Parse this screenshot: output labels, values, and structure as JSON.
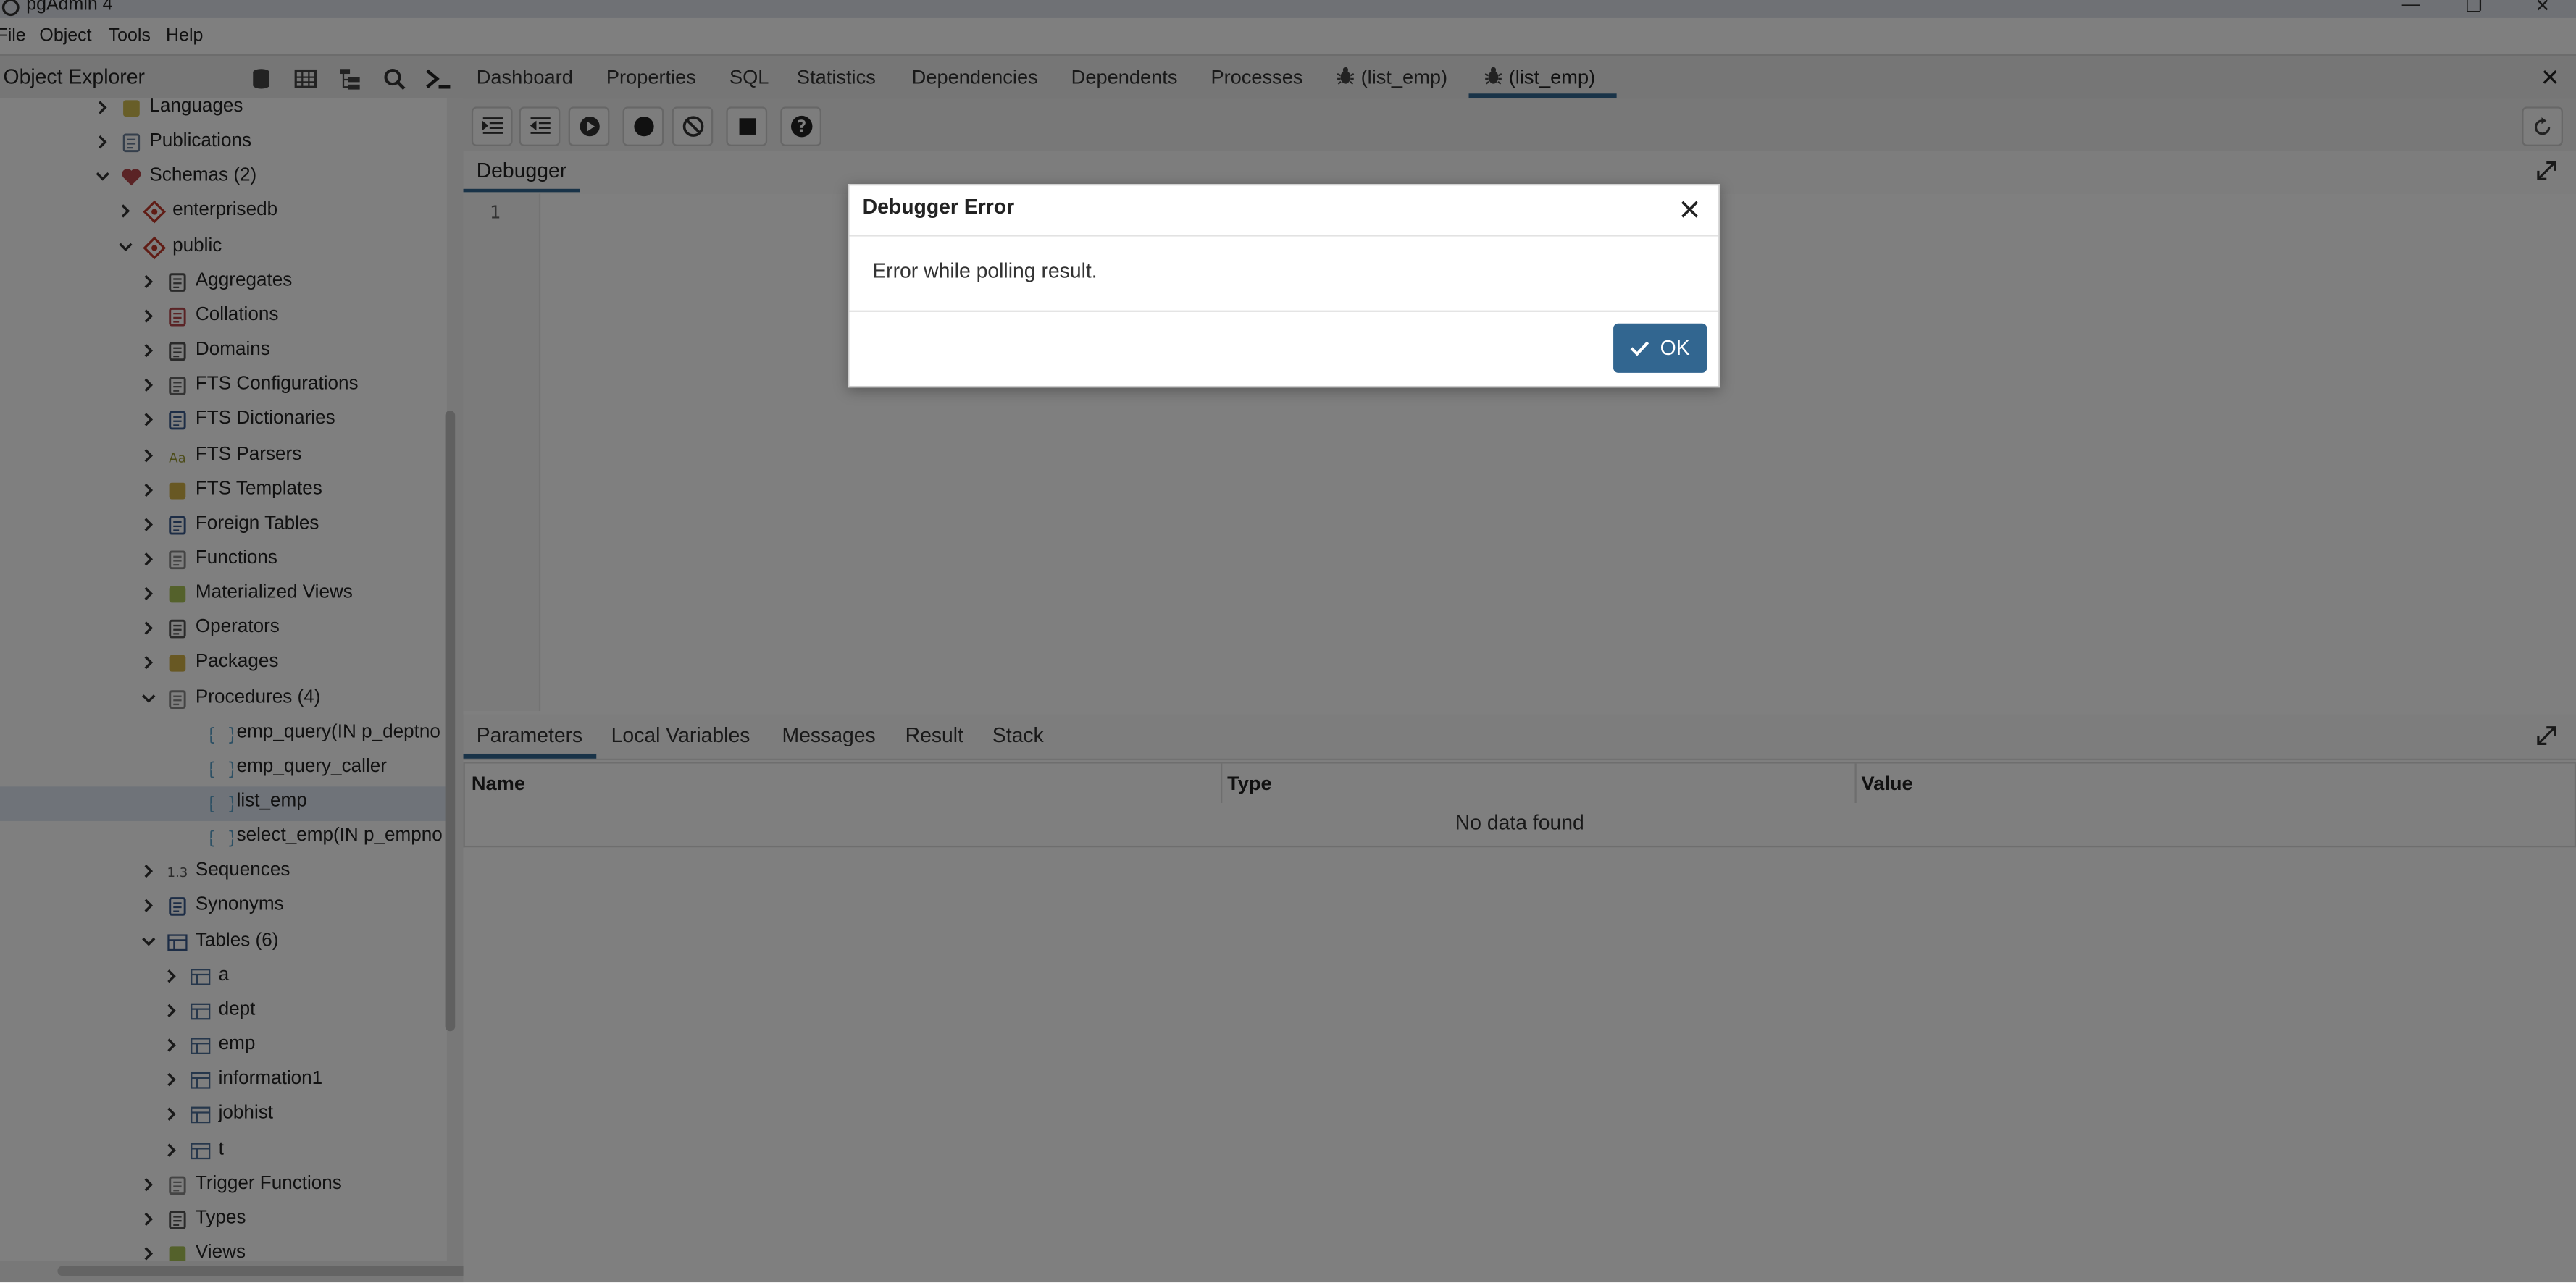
{
  "window": {
    "title": "pgAdmin 4",
    "controls": [
      "—",
      "❐",
      "✕"
    ]
  },
  "menu": [
    "File",
    "Object",
    "Tools",
    "Help"
  ],
  "object_explorer": {
    "title": "Object Explorer",
    "toolbar_icons": [
      "database-icon",
      "table-icon",
      "hierarchy-icon",
      "search-icon",
      "terminal-icon"
    ],
    "tree": [
      {
        "label": "Languages",
        "depth": 2,
        "expanded": false,
        "icon": "languages-icon"
      },
      {
        "label": "Publications",
        "depth": 2,
        "expanded": false,
        "icon": "publications-icon"
      },
      {
        "label": "Schemas (2)",
        "depth": 2,
        "expanded": true,
        "icon": "schemas-icon"
      },
      {
        "label": "enterprisedb",
        "depth": 3,
        "expanded": false,
        "icon": "schema-icon"
      },
      {
        "label": "public",
        "depth": 3,
        "expanded": true,
        "icon": "schema-icon"
      },
      {
        "label": "Aggregates",
        "depth": 4,
        "expanded": false,
        "icon": "aggregates-icon"
      },
      {
        "label": "Collations",
        "depth": 4,
        "expanded": false,
        "icon": "collations-icon"
      },
      {
        "label": "Domains",
        "depth": 4,
        "expanded": false,
        "icon": "domains-icon"
      },
      {
        "label": "FTS Configurations",
        "depth": 4,
        "expanded": false,
        "icon": "fts-config-icon"
      },
      {
        "label": "FTS Dictionaries",
        "depth": 4,
        "expanded": false,
        "icon": "fts-dict-icon"
      },
      {
        "label": "FTS Parsers",
        "depth": 4,
        "expanded": false,
        "icon": "fts-parser-icon"
      },
      {
        "label": "FTS Templates",
        "depth": 4,
        "expanded": false,
        "icon": "fts-template-icon"
      },
      {
        "label": "Foreign Tables",
        "depth": 4,
        "expanded": false,
        "icon": "foreign-table-icon"
      },
      {
        "label": "Functions",
        "depth": 4,
        "expanded": false,
        "icon": "functions-icon"
      },
      {
        "label": "Materialized Views",
        "depth": 4,
        "expanded": false,
        "icon": "matview-icon"
      },
      {
        "label": "Operators",
        "depth": 4,
        "expanded": false,
        "icon": "operators-icon"
      },
      {
        "label": "Packages",
        "depth": 4,
        "expanded": false,
        "icon": "packages-icon"
      },
      {
        "label": "Procedures (4)",
        "depth": 4,
        "expanded": true,
        "icon": "procedures-icon"
      },
      {
        "label": "emp_query(IN p_deptno num",
        "depth": 5,
        "leaf": true,
        "icon": "procedure-icon"
      },
      {
        "label": "emp_query_caller",
        "depth": 5,
        "leaf": true,
        "icon": "procedure-icon"
      },
      {
        "label": "list_emp",
        "depth": 5,
        "leaf": true,
        "icon": "procedure-icon",
        "selected": true
      },
      {
        "label": "select_emp(IN p_empno nu",
        "depth": 5,
        "leaf": true,
        "icon": "procedure-icon"
      },
      {
        "label": "Sequences",
        "depth": 4,
        "expanded": false,
        "icon": "sequences-icon"
      },
      {
        "label": "Synonyms",
        "depth": 4,
        "expanded": false,
        "icon": "synonyms-icon"
      },
      {
        "label": "Tables (6)",
        "depth": 4,
        "expanded": true,
        "icon": "tables-icon"
      },
      {
        "label": "a",
        "depth": 5,
        "expanded": false,
        "icon": "table-icon"
      },
      {
        "label": "dept",
        "depth": 5,
        "expanded": false,
        "icon": "table-icon"
      },
      {
        "label": "emp",
        "depth": 5,
        "expanded": false,
        "icon": "table-icon"
      },
      {
        "label": "information1",
        "depth": 5,
        "expanded": false,
        "icon": "table-icon"
      },
      {
        "label": "jobhist",
        "depth": 5,
        "expanded": false,
        "icon": "table-icon"
      },
      {
        "label": "t",
        "depth": 5,
        "expanded": false,
        "icon": "table-icon"
      },
      {
        "label": "Trigger Functions",
        "depth": 4,
        "expanded": false,
        "icon": "trigger-functions-icon"
      },
      {
        "label": "Types",
        "depth": 4,
        "expanded": false,
        "icon": "types-icon"
      },
      {
        "label": "Views",
        "depth": 4,
        "expanded": false,
        "icon": "views-icon"
      }
    ]
  },
  "tabs": [
    {
      "label": "Dashboard"
    },
    {
      "label": "Properties"
    },
    {
      "label": "SQL"
    },
    {
      "label": "Statistics"
    },
    {
      "label": "Dependencies"
    },
    {
      "label": "Dependents"
    },
    {
      "label": "Processes"
    },
    {
      "label": "(list_emp)",
      "icon": "bug-icon"
    },
    {
      "label": "(list_emp)",
      "icon": "bug-icon",
      "active": true
    }
  ],
  "debugger": {
    "toolbar": [
      "step-into-icon",
      "step-over-icon",
      "continue-icon",
      "breakpoint-icon",
      "clear-breakpoints-icon",
      "stop-icon",
      "help-icon"
    ],
    "panel_title": "Debugger",
    "line_number": "1",
    "bottom_tabs": [
      "Parameters",
      "Local Variables",
      "Messages",
      "Result",
      "Stack"
    ],
    "grid_columns": [
      "Name",
      "Type",
      "Value"
    ],
    "empty_text": "No data found"
  },
  "dialog": {
    "title": "Debugger Error",
    "message": "Error while polling result.",
    "ok_label": "OK"
  },
  "colors": {
    "accent": "#326690",
    "overlay": "rgba(0,0,0,0.5)"
  }
}
